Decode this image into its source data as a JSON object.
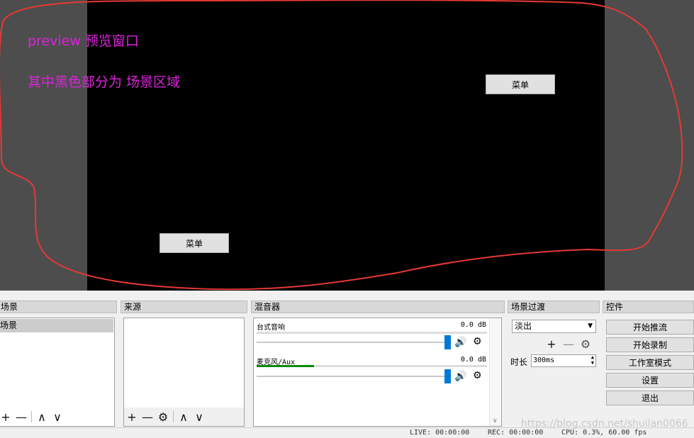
{
  "preview": {
    "annotation_line1": "preview 预览窗口",
    "annotation_line2": "其中黑色部分为 场景区域",
    "menu_button_1": "菜单",
    "menu_button_2": "菜单"
  },
  "docks": {
    "scenes": {
      "title": "场景",
      "items": [
        "场景"
      ]
    },
    "sources": {
      "title": "来源"
    },
    "mixer": {
      "title": "混音器",
      "channels": [
        {
          "name": "台式音响",
          "db": "0.0 dB",
          "level": 0.0
        },
        {
          "name": "麦克风/Aux",
          "db": "0.0 dB",
          "level": 0.25
        }
      ]
    },
    "transitions": {
      "title": "场景过渡",
      "selected": "淡出",
      "duration_label": "时长",
      "duration_value": "300ms"
    },
    "controls": {
      "title": "控件",
      "buttons": [
        "开始推流",
        "开始录制",
        "工作室模式",
        "设置",
        "退出"
      ]
    }
  },
  "toolbar_glyphs": {
    "add": "+",
    "remove": "—",
    "up": "∧",
    "down": "∨",
    "gear": "⚙"
  },
  "status_bar": {
    "live": "LIVE: 00:00:00",
    "rec": "REC: 00:00:00",
    "cpu": "CPU: 0.3%, 60.00 fps"
  },
  "watermark": "https://blog.csdn.net/shuilan0066",
  "colors": {
    "annotation": "#dd22dd",
    "outline": "#e53935",
    "accent": "#0078d7",
    "meter": "#0a8a0a"
  }
}
